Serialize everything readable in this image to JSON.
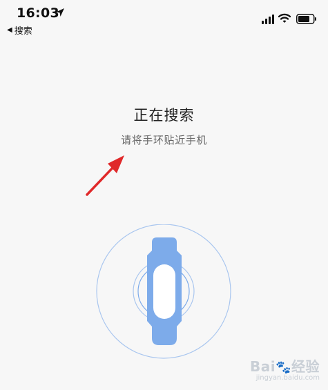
{
  "status_bar": {
    "time": "16:03",
    "back_label": "搜索"
  },
  "main": {
    "title": "正在搜索",
    "subtitle": "请将手环贴近手机"
  },
  "icons": {
    "location": "location-arrow-icon",
    "signal": "cellular-signal-icon",
    "wifi": "wifi-icon",
    "battery": "battery-icon",
    "annotation": "red-arrow-annotation",
    "band": "fitness-band-icon"
  },
  "colors": {
    "background": "#f7f7f7",
    "band_blue": "#7dabea",
    "band_screen": "#ffffff",
    "circle_blue": "#a9c6ef",
    "arrow_red": "#e0292a"
  },
  "watermark": {
    "main_left": "Bai",
    "main_right": "经验",
    "url": "jingyan.baidu.com"
  }
}
